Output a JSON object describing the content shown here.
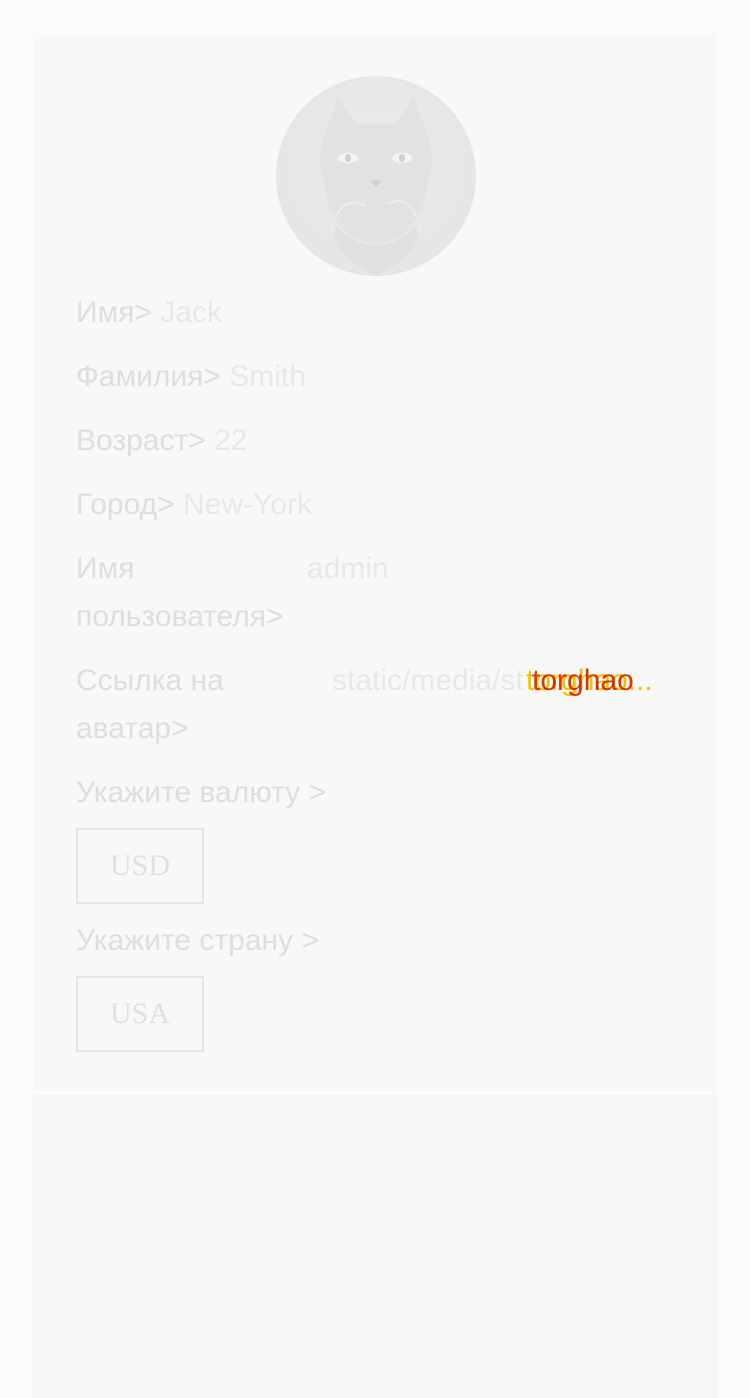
{
  "profile": {
    "avatar_icon": "cat-avatar",
    "first_name": {
      "label": "Имя>",
      "value": "Jack"
    },
    "last_name": {
      "label": "Фамилия>",
      "value": "Smith"
    },
    "age": {
      "label": "Возраст>",
      "value": "22"
    },
    "city": {
      "label": "Город>",
      "value": "New-York"
    },
    "username": {
      "label": "Имя пользователя>",
      "value": "admin"
    },
    "avatar_link": {
      "label": "Ссылка на аватар>",
      "value": "static/media/st",
      "overlay_text_a": "torghao",
      "overlay_text_b": "..."
    }
  },
  "currency": {
    "label": "Укажите валюту >",
    "selected": "USD"
  },
  "country": {
    "label": "Укажите страну >",
    "selected": "USA"
  },
  "colors": {
    "background": "#fbfbfb",
    "card": "#f8f8f8",
    "text": "#e2e2e2",
    "highlight_yellow": "#f2c200",
    "highlight_red": "#e03a00"
  }
}
